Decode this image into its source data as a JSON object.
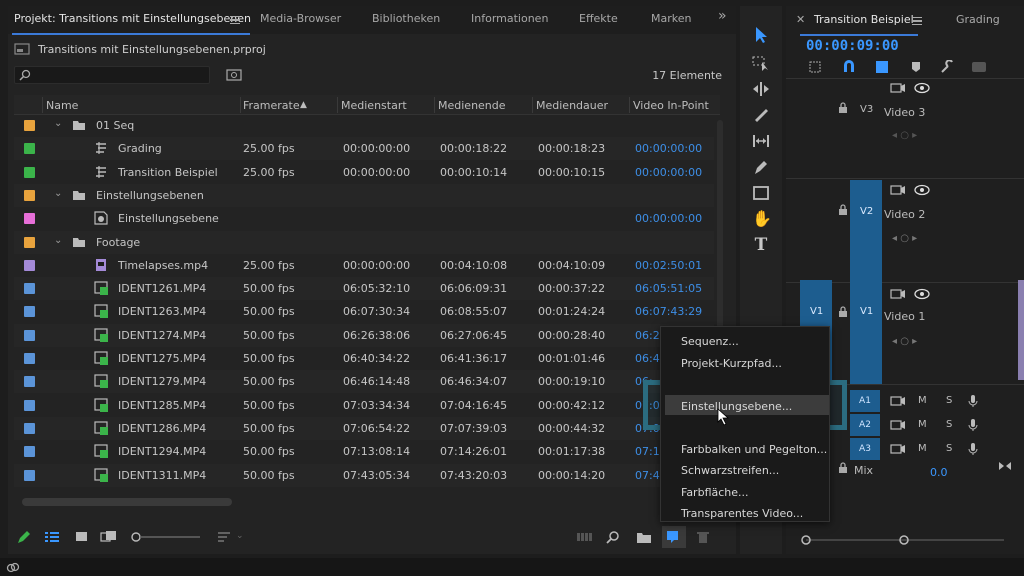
{
  "project_panel": {
    "tabs": [
      {
        "label": "Projekt: Transitions mit Einstellungsebenen",
        "active": true
      },
      {
        "label": "Media-Browser"
      },
      {
        "label": "Bibliotheken"
      },
      {
        "label": "Informationen"
      },
      {
        "label": "Effekte"
      },
      {
        "label": "Marken"
      }
    ],
    "overflow": "»",
    "file_name": "Transitions mit Einstellungsebenen.prproj",
    "search_placeholder": "",
    "item_count": "17 Elemente",
    "columns": [
      "Name",
      "Framerate",
      "Medienstart",
      "Medienende",
      "Mediendauer",
      "Video In-Point"
    ],
    "sort_indicator": "▲",
    "rows": [
      {
        "type": "bin",
        "indent": 1,
        "color": "#e8a33d",
        "name": "01 Seq",
        "expanded": true,
        "fps": "",
        "start": "",
        "end": "",
        "dur": "",
        "inpoint": ""
      },
      {
        "type": "sequence",
        "indent": 2,
        "color": "#3bb44a",
        "name": "Grading",
        "fps": "25.00 fps",
        "start": "00:00:00:00",
        "end": "00:00:18:22",
        "dur": "00:00:18:23",
        "inpoint": "00:00:00:00"
      },
      {
        "type": "sequence",
        "indent": 2,
        "color": "#3bb44a",
        "name": "Transition Beispiel",
        "fps": "25.00 fps",
        "start": "00:00:00:00",
        "end": "00:00:10:14",
        "dur": "00:00:10:15",
        "inpoint": "00:00:00:00"
      },
      {
        "type": "bin",
        "indent": 1,
        "color": "#e8a33d",
        "name": "Einstellungsebenen",
        "expanded": true,
        "fps": "",
        "start": "",
        "end": "",
        "dur": "",
        "inpoint": ""
      },
      {
        "type": "adjustment",
        "indent": 2,
        "color": "#e76fd8",
        "name": "Einstellungsebene",
        "fps": "",
        "start": "",
        "end": "",
        "dur": "",
        "inpoint": "00:00:00:00"
      },
      {
        "type": "bin",
        "indent": 1,
        "color": "#e8a33d",
        "name": "Footage",
        "expanded": true,
        "fps": "",
        "start": "",
        "end": "",
        "dur": "",
        "inpoint": ""
      },
      {
        "type": "clip",
        "indent": 2,
        "color": "#a48ad8",
        "name": "Timelapses.mp4",
        "fps": "25.00 fps",
        "start": "00:00:00:00",
        "end": "00:04:10:08",
        "dur": "00:04:10:09",
        "inpoint": "00:02:50:01"
      },
      {
        "type": "clip",
        "indent": 2,
        "color": "#5b94d8",
        "name": "IDENT1261.MP4",
        "fps": "50.00 fps",
        "start": "06:05:32:10",
        "end": "06:06:09:31",
        "dur": "00:00:37:22",
        "inpoint": "06:05:51:05"
      },
      {
        "type": "clip",
        "indent": 2,
        "color": "#5b94d8",
        "name": "IDENT1263.MP4",
        "fps": "50.00 fps",
        "start": "06:07:30:34",
        "end": "06:08:55:07",
        "dur": "00:01:24:24",
        "inpoint": "06:07:43:29"
      },
      {
        "type": "clip",
        "indent": 2,
        "color": "#5b94d8",
        "name": "IDENT1274.MP4",
        "fps": "50.00 fps",
        "start": "06:26:38:06",
        "end": "06:27:06:45",
        "dur": "00:00:28:40",
        "inpoint": "06:27"
      },
      {
        "type": "clip",
        "indent": 2,
        "color": "#5b94d8",
        "name": "IDENT1275.MP4",
        "fps": "50.00 fps",
        "start": "06:40:34:22",
        "end": "06:41:36:17",
        "dur": "00:01:01:46",
        "inpoint": "06:41"
      },
      {
        "type": "clip",
        "indent": 2,
        "color": "#5b94d8",
        "name": "IDENT1279.MP4",
        "fps": "50.00 fps",
        "start": "06:46:14:48",
        "end": "06:46:34:07",
        "dur": "00:00:19:10",
        "inpoint": "06:"
      },
      {
        "type": "clip",
        "indent": 2,
        "color": "#5b94d8",
        "name": "IDENT1285.MP4",
        "fps": "50.00 fps",
        "start": "07:03:34:34",
        "end": "07:04:16:45",
        "dur": "00:00:42:12",
        "inpoint": "07:0"
      },
      {
        "type": "clip",
        "indent": 2,
        "color": "#5b94d8",
        "name": "IDENT1286.MP4",
        "fps": "50.00 fps",
        "start": "07:06:54:22",
        "end": "07:07:39:03",
        "dur": "00:00:44:32",
        "inpoint": "07:0"
      },
      {
        "type": "clip",
        "indent": 2,
        "color": "#5b94d8",
        "name": "IDENT1294.MP4",
        "fps": "50.00 fps",
        "start": "07:13:08:14",
        "end": "07:14:26:01",
        "dur": "00:01:17:38",
        "inpoint": "07:13"
      },
      {
        "type": "clip",
        "indent": 2,
        "color": "#5b94d8",
        "name": "IDENT1311.MP4",
        "fps": "50.00 fps",
        "start": "07:43:05:34",
        "end": "07:43:20:03",
        "dur": "00:00:14:20",
        "inpoint": "07:43"
      }
    ]
  },
  "context_menu": {
    "items": [
      "Sequenz...",
      "Projekt-Kurzpfad...",
      "",
      "Einstellungsebene...",
      "",
      "Farbbalken und Pegelton...",
      "Schwarzstreifen...",
      "Farbfläche...",
      "Transparentes Video..."
    ],
    "highlighted": "Einstellungsebene..."
  },
  "timeline": {
    "tabs": [
      {
        "label": "Transition Beispiel",
        "active": true
      },
      {
        "label": "Grading"
      }
    ],
    "close_glyph": "✕",
    "timecode": "00:00:09:00",
    "video_tracks": [
      {
        "target": "V3",
        "name": "Video 3"
      },
      {
        "target": "V2",
        "name": "Video 2"
      },
      {
        "source": "V1",
        "target": "V1",
        "name": "Video 1"
      }
    ],
    "audio_tracks": [
      "A1",
      "A2",
      "A3"
    ],
    "mute_label": "M",
    "solo_label": "S",
    "mix_label": "Mix",
    "mix_value": "0.0"
  },
  "colors": {
    "accent_blue": "#3a97ff",
    "track_blue": "#1d5d8f",
    "highlight_teal": "#2b6c80"
  }
}
